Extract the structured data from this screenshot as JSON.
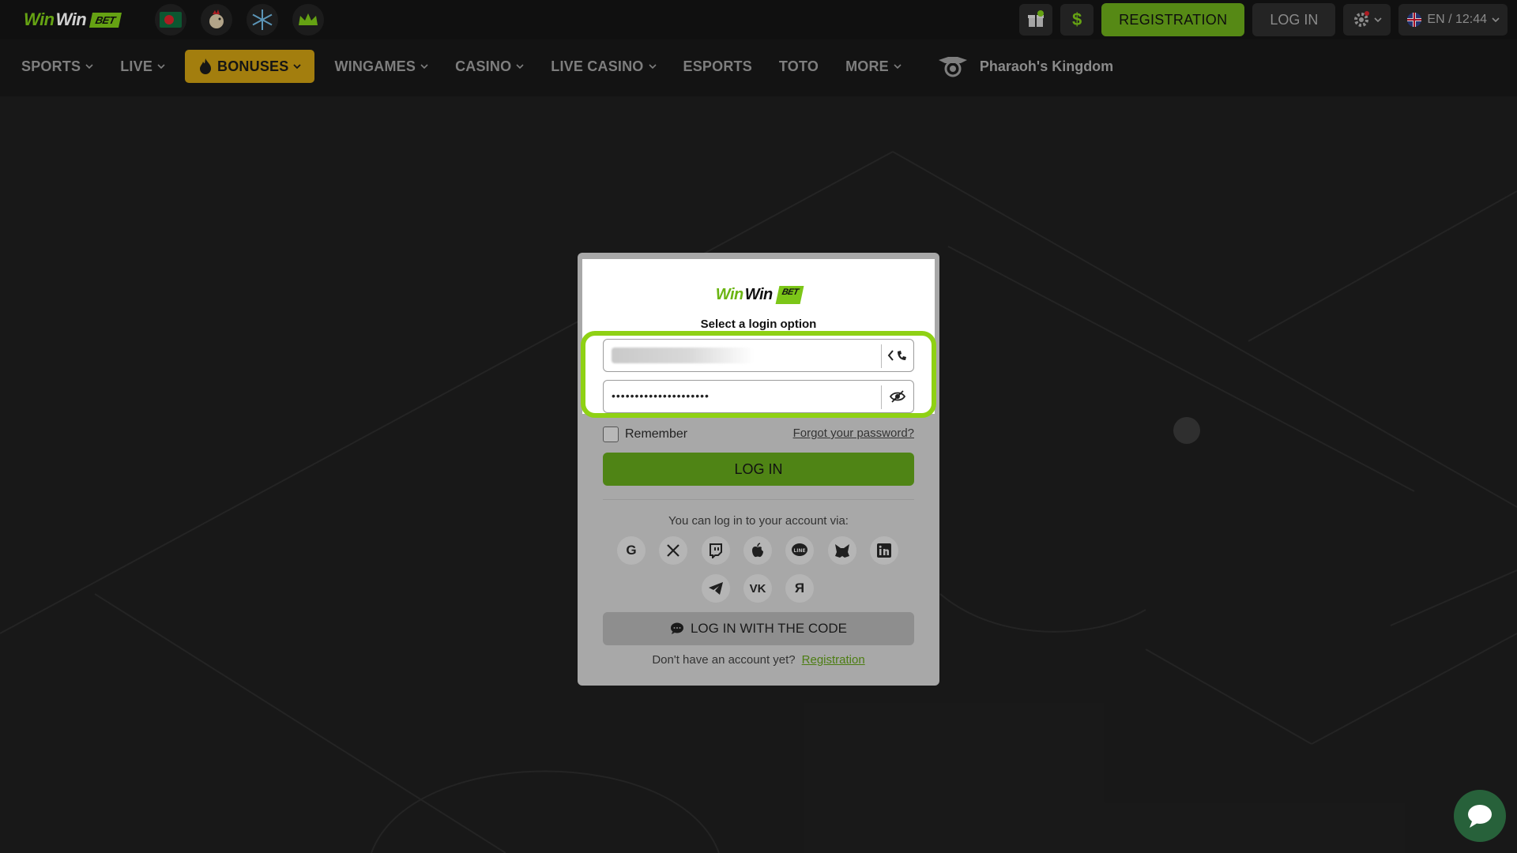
{
  "header": {
    "logo": {
      "part1": "Win",
      "part2": "Win",
      "badge": "BET"
    },
    "registration_label": "REGISTRATION",
    "login_label": "LOG IN",
    "lang_time": "EN / 12:44",
    "gift_count": "1"
  },
  "nav": {
    "items": [
      {
        "label": "SPORTS",
        "dropdown": true
      },
      {
        "label": "LIVE",
        "dropdown": true
      },
      {
        "label": "BONUSES",
        "dropdown": true,
        "active": true
      },
      {
        "label": "WINGAMES",
        "dropdown": true
      },
      {
        "label": "CASINO",
        "dropdown": true
      },
      {
        "label": "LIVE CASINO",
        "dropdown": true
      },
      {
        "label": "ESPORTS",
        "dropdown": false
      },
      {
        "label": "TOTO",
        "dropdown": false
      },
      {
        "label": "MORE",
        "dropdown": true
      }
    ],
    "promo_game": "Pharaoh's Kingdom"
  },
  "modal": {
    "logo": {
      "part1": "Win",
      "part2": "Win",
      "badge": "BET"
    },
    "title": "Select a login option",
    "password_mask": "•••••••••••••••••••••",
    "remember_label": "Remember",
    "forgot_label": "Forgot your password?",
    "login_button": "LOG IN",
    "via_text": "You can log in to your account via:",
    "social": [
      "google-icon",
      "x-icon",
      "twitch-icon",
      "apple-icon",
      "line-icon",
      "metamask-icon",
      "linkedin-icon",
      "telegram-icon",
      "vk-icon",
      "yandex-icon"
    ],
    "code_button": "LOG IN WITH THE CODE",
    "no_account_text": "Don't have an account yet?",
    "registration_link": "Registration"
  },
  "colors": {
    "brand_green": "#7cc618",
    "highlight_green": "#8fd114",
    "bonus_gold": "#c79a12"
  }
}
